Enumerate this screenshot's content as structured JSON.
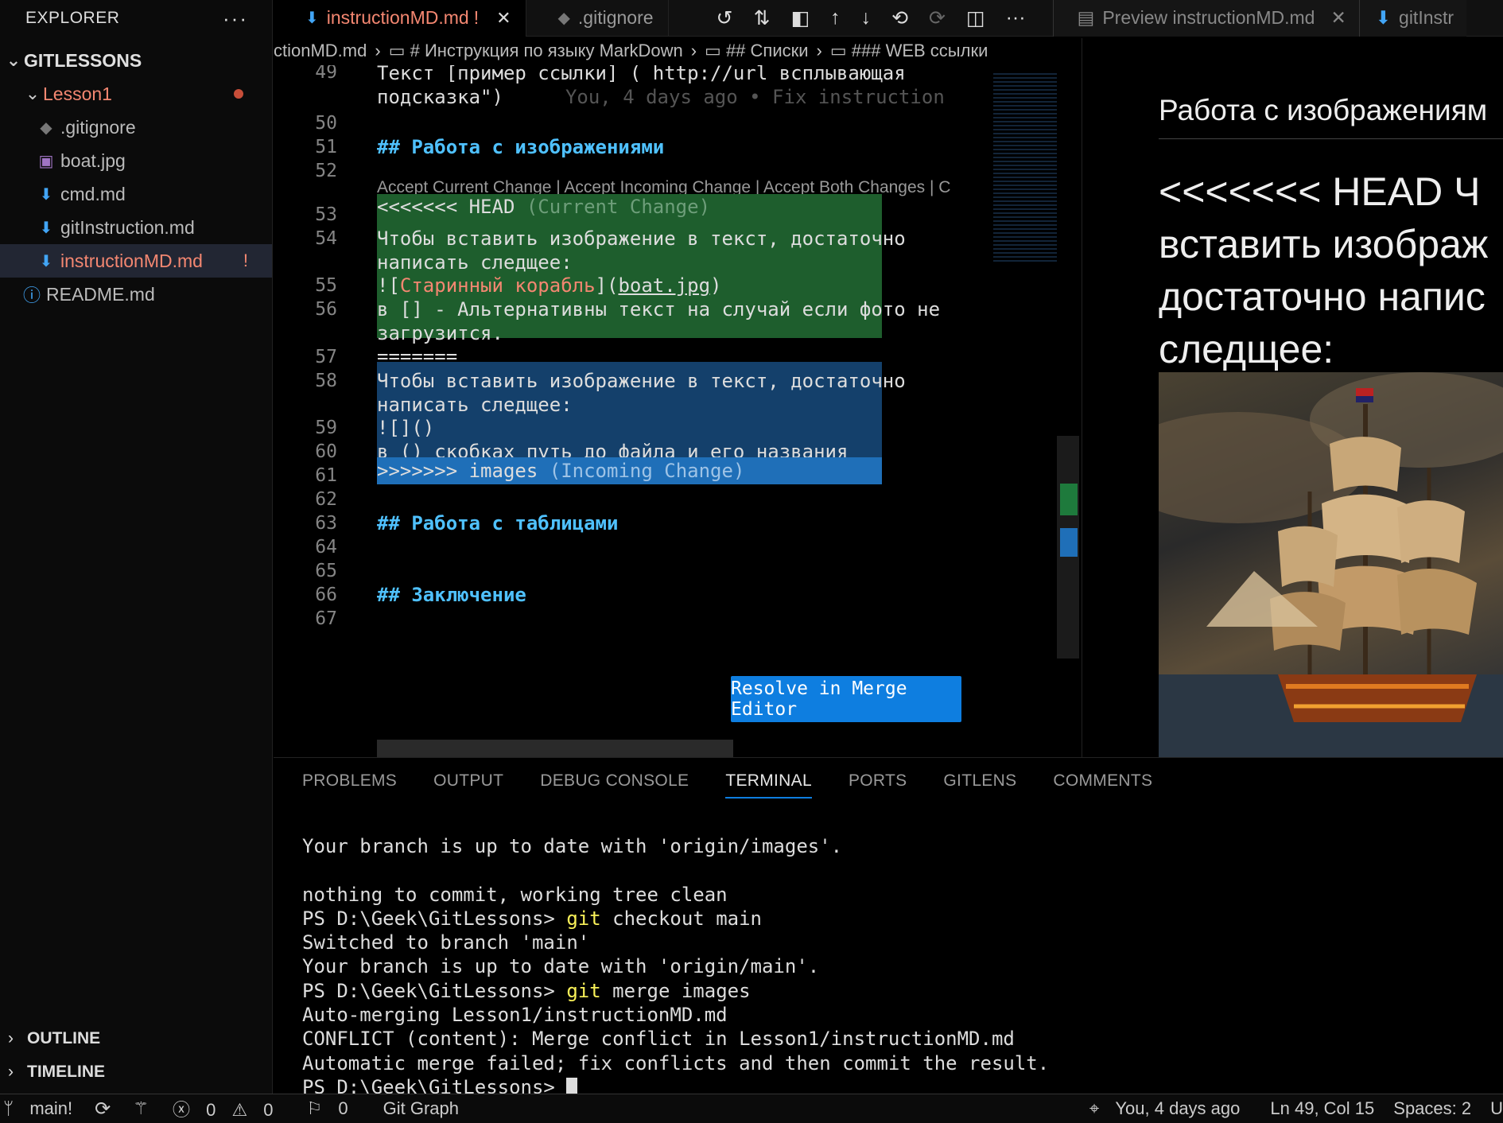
{
  "sidebar": {
    "title": "EXPLORER",
    "more": "···",
    "root": "GITLESSONS",
    "folder": "Lesson1",
    "files": [
      {
        "name": ".gitignore",
        "icon": "◆"
      },
      {
        "name": "boat.jpg",
        "icon": "▣"
      },
      {
        "name": "cmd.md",
        "icon": "⬇"
      },
      {
        "name": "gitInstruction.md",
        "icon": "⬇"
      },
      {
        "name": "instructionMD.md",
        "icon": "⬇",
        "badge": "!"
      }
    ],
    "readme": "README.md",
    "outline": "OUTLINE",
    "timeline": "TIMELINE"
  },
  "tabs": {
    "active": {
      "label": "instructionMD.md",
      "badge": "!",
      "close": "✕"
    },
    "second": {
      "label": ".gitignore"
    },
    "preview": {
      "label": "Preview instructionMD.md",
      "close": "✕"
    },
    "partial": {
      "label": "gitInstr"
    }
  },
  "breadcrumb": [
    "ctionMD.md",
    "# Инструкция по языку MarkDown",
    "## Списки",
    "### WEB ссылки"
  ],
  "editor": {
    "lines": [
      {
        "n": "49",
        "text": "Текст [пример ссылки] ( http://url  всплывающая"
      },
      {
        "n": "",
        "text": "подсказка\")",
        "blame": "You, 4 days ago • Fix instruction"
      },
      {
        "n": "50",
        "text": ""
      },
      {
        "n": "51",
        "text": "## Работа с изображениями"
      },
      {
        "n": "52",
        "text": ""
      },
      {
        "n": "53",
        "text": "<<<<<<< HEAD",
        "note": "(Current Change)"
      },
      {
        "n": "54",
        "text": "Чтобы вставить изображение в текст, достаточно"
      },
      {
        "n": "",
        "text": "написать следщее:"
      },
      {
        "n": "55",
        "text_a": "![",
        "text_b": "Старинный корабль",
        "text_c": "](",
        "text_d": "boat.jpg",
        "text_e": ")"
      },
      {
        "n": "56",
        "text": "в [] - Альтернативны текст на случай если фото не"
      },
      {
        "n": "",
        "text": "загрузится."
      },
      {
        "n": "57",
        "text": "======="
      },
      {
        "n": "58",
        "text": "Чтобы вставить изображение в текст, достаточно"
      },
      {
        "n": "",
        "text": "написать следщее:"
      },
      {
        "n": "59",
        "text": "![]()"
      },
      {
        "n": "60",
        "text": "в () скобках путь до файла и его названия"
      },
      {
        "n": "61",
        "text": ">>>>>>> images",
        "note": "(Incoming Change)"
      },
      {
        "n": "62",
        "text": ""
      },
      {
        "n": "63",
        "text": "## Работа с таблицами"
      },
      {
        "n": "64",
        "text": ""
      },
      {
        "n": "65",
        "text": ""
      },
      {
        "n": "66",
        "text": "## Заключение"
      },
      {
        "n": "67",
        "text": ""
      }
    ],
    "codelens": "Accept Current Change | Accept Incoming Change | Accept Both Changes | C",
    "resolve_button": "Resolve in Merge Editor"
  },
  "preview": {
    "heading": "Работа с изображениям",
    "paragraph": [
      "<<<<<<< HEAD Ч",
      "вставить изображ",
      "достаточно напис",
      "следщее:"
    ]
  },
  "panel": {
    "tabs": [
      "PROBLEMS",
      "OUTPUT",
      "DEBUG CONSOLE",
      "TERMINAL",
      "PORTS",
      "GITLENS",
      "COMMENTS"
    ],
    "active_tab": "TERMINAL",
    "terminal": [
      "Your branch is up to date with 'origin/images'.",
      "",
      "nothing to commit, working tree clean",
      "PS D:\\Geek\\GitLessons> |git| checkout main",
      "Switched to branch 'main'",
      "Your branch is up to date with 'origin/main'.",
      "PS D:\\Geek\\GitLessons> |git| merge images",
      "Auto-merging Lesson1/instructionMD.md",
      "CONFLICT (content): Merge conflict in Lesson1/instructionMD.md",
      "Automatic merge failed; fix conflicts and then commit the result.",
      "PS D:\\Geek\\GitLessons> "
    ]
  },
  "status": {
    "branch": "main!",
    "errors": "0",
    "warnings": "0",
    "ports": "0",
    "git_graph": "Git Graph",
    "blame": "You, 4 days ago",
    "position": "Ln 49, Col 15",
    "spaces": "Spaces: 2",
    "trail": "U"
  },
  "colors": {
    "accent": "#0e7ee0",
    "modified": "#f48771",
    "current": "#1e5e2d",
    "incoming": "#14406b"
  }
}
